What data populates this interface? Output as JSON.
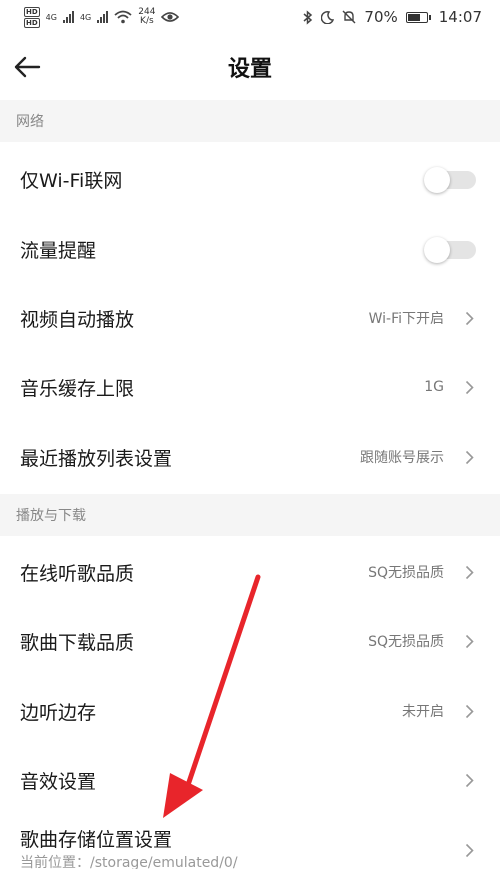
{
  "status_bar": {
    "hd1": "HD",
    "hd2": "HD",
    "net1": "4G",
    "net2": "4G",
    "speed_value": "244",
    "speed_unit": "K/s",
    "battery": "70%",
    "time": "14:07"
  },
  "header": {
    "title": "设置"
  },
  "sections": {
    "network": {
      "title": "网络",
      "wifi_only_label": "仅Wi-Fi联网",
      "data_alert_label": "流量提醒",
      "video_autoplay_label": "视频自动播放",
      "video_autoplay_value": "Wi-Fi下开启",
      "cache_limit_label": "音乐缓存上限",
      "cache_limit_value": "1G",
      "recent_playlist_label": "最近播放列表设置",
      "recent_playlist_value": "跟随账号展示"
    },
    "playback": {
      "title": "播放与下载",
      "online_quality_label": "在线听歌品质",
      "online_quality_value": "SQ无损品质",
      "download_quality_label": "歌曲下载品质",
      "download_quality_value": "SQ无损品质",
      "cache_while_play_label": "边听边存",
      "cache_while_play_value": "未开启",
      "sound_effect_label": "音效设置",
      "storage_label": "歌曲存储位置设置",
      "storage_path": "当前位置：/storage/emulated/0/"
    }
  },
  "toggles": {
    "wifi_only": false,
    "data_alert": false
  },
  "colors": {
    "annotation_arrow": "#e8252b",
    "toggle_off": "#e4e4e4",
    "section_bg": "#f5f5f5"
  }
}
